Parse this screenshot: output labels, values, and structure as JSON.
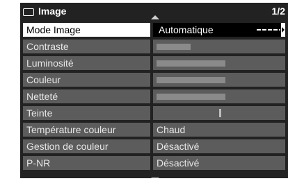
{
  "header": {
    "title": "Image",
    "title_icon": "screen-icon",
    "page_indicator": "1/2"
  },
  "menu": {
    "items": [
      {
        "label": "Mode Image",
        "value": "Automatique",
        "selected": true
      },
      {
        "label": "Contraste",
        "value": "",
        "level": 0.27
      },
      {
        "label": "Luminosité",
        "value": "",
        "level": 0.55
      },
      {
        "label": "Couleur",
        "value": "",
        "level": 0.55
      },
      {
        "label": "Netteté",
        "value": "",
        "level": 0.55
      },
      {
        "label": "Teinte",
        "value": "",
        "level": 0.5
      },
      {
        "label": "Température couleur",
        "value": "Chaud"
      },
      {
        "label": "Gestion de couleur",
        "value": "Désactivé"
      },
      {
        "label": "P-NR",
        "value": "Désactivé"
      }
    ]
  },
  "colors": {
    "panel_bg": "#222222",
    "cell_bg": "#5c5c5c",
    "selected_bg": "#ffffff",
    "bar_fill": "#8a8a8a"
  }
}
